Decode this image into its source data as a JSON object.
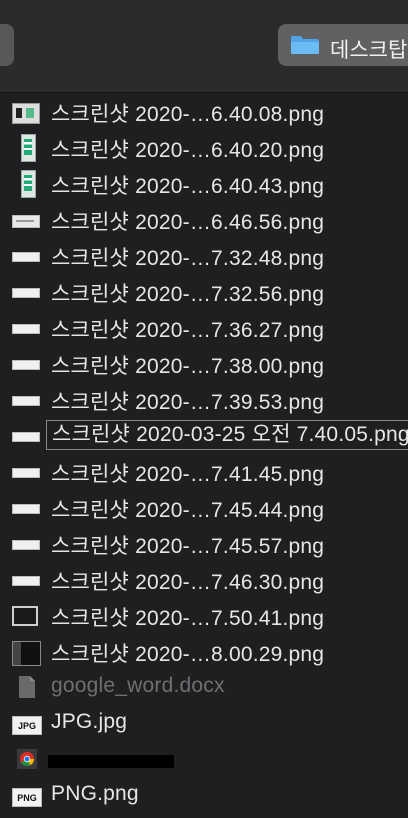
{
  "toolbar": {
    "folder_label": "데스크탑",
    "folder_icon": "folder-icon"
  },
  "files": [
    {
      "name": "스크린샷 2020-…6.40.08.png",
      "thumb": "window"
    },
    {
      "name": "스크린샷 2020-…6.40.20.png",
      "thumb": "tall"
    },
    {
      "name": "스크린샷 2020-…6.40.43.png",
      "thumb": "tall"
    },
    {
      "name": "스크린샷 2020-…6.46.56.png",
      "thumb": "wide"
    },
    {
      "name": "스크린샷 2020-…7.32.48.png",
      "thumb": "flat"
    },
    {
      "name": "스크린샷 2020-…7.32.56.png",
      "thumb": "flat"
    },
    {
      "name": "스크린샷 2020-…7.36.27.png",
      "thumb": "flat"
    },
    {
      "name": "스크린샷 2020-…7.38.00.png",
      "thumb": "flat"
    },
    {
      "name": "스크린샷 2020-…7.39.53.png",
      "thumb": "flat"
    },
    {
      "name": "스크린샷 2020-03-25 오전 7.40.05.png",
      "thumb": "flat",
      "selected": true
    },
    {
      "name": "스크린샷 2020-…7.41.45.png",
      "thumb": "flat"
    },
    {
      "name": "스크린샷 2020-…7.45.44.png",
      "thumb": "flat"
    },
    {
      "name": "스크린샷 2020-…7.45.57.png",
      "thumb": "flat"
    },
    {
      "name": "스크린샷 2020-…7.46.30.png",
      "thumb": "flat"
    },
    {
      "name": "스크린샷 2020-…7.50.41.png",
      "thumb": "dark"
    },
    {
      "name": "스크린샷 2020-…8.00.29.png",
      "thumb": "dark2"
    },
    {
      "name": "google_word.docx",
      "thumb": "doc",
      "dim": true
    },
    {
      "name": "JPG.jpg",
      "thumb": "badge",
      "badge": "JPG"
    },
    {
      "name": "",
      "thumb": "chrome",
      "redacted": true
    },
    {
      "name": "PNG.png",
      "thumb": "badge",
      "badge": "PNG"
    }
  ]
}
